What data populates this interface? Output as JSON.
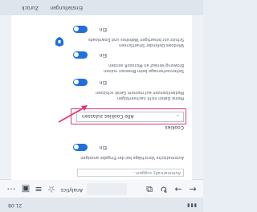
{
  "status": {
    "time": "21:08",
    "signal": "▮▮▮"
  },
  "navbar": {
    "address": "Analytics",
    "icons": [
      "back-icon",
      "forward-icon",
      "tabs-icon",
      "refresh-icon",
      "favorites-icon",
      "menu-icon",
      "share-icon",
      "more-icon"
    ]
  },
  "settings": {
    "top_input_placeholder": "Automatically suggest...",
    "block_popups": {
      "toggle_label": "Ein",
      "description_line1": "Automatische Vorschläge bei der Eingabe anzeigen"
    },
    "cookies": {
      "section_label": "Cookies",
      "select_value": "Alle Cookies zulassen"
    },
    "do_not_track": {
      "toggle_label": "Ein",
      "description_line1": "Meine Daten nicht nachverfolgen",
      "description_line2": "Medienlizenzen auf meinem Gerät schützen"
    },
    "search_suggestions": {
      "toggle_label": "Ein",
      "description_line1": "Seitenvorhersage beim Browsen nutzen",
      "description_line2": "Browsing-Verlauf an Microsoft senden"
    },
    "smartscreen": {
      "toggle_label": "Ein",
      "description_line1": "Windows Defender SmartScreen",
      "description_line2": "Schutz vor bösartigen Websites und Downloads"
    }
  },
  "tabs": {
    "left_label": "Zurück",
    "right_label": "Einstellungen"
  }
}
